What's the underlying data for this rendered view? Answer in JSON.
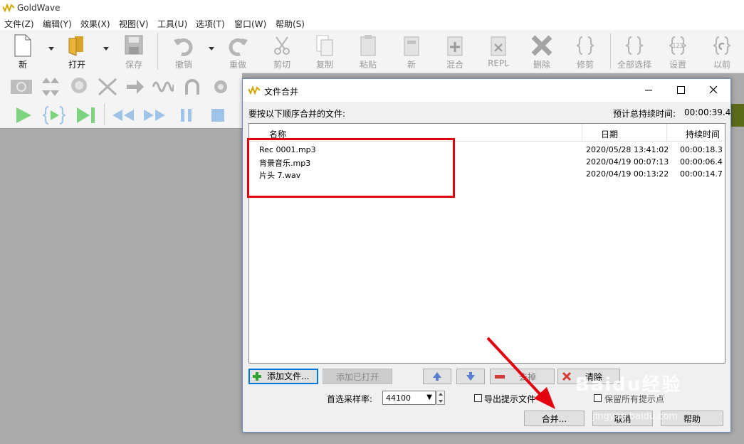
{
  "app": {
    "title": "GoldWave"
  },
  "menu": [
    "文件(Z)",
    "编辑(Y)",
    "效果(X)",
    "视图(V)",
    "工具(U)",
    "选项(T)",
    "窗口(W)",
    "帮助(S)"
  ],
  "toolbar": {
    "new": "新",
    "open": "打开",
    "save": "保存",
    "undo": "撤销",
    "redo": "重做",
    "cut": "剪切",
    "copy": "复制",
    "paste": "粘贴",
    "paste_new": "新",
    "mix": "混合",
    "repl": "REPL",
    "delete": "删除",
    "trim": "修剪",
    "select_all": "全部选择",
    "settings": "设置",
    "previous": "以前"
  },
  "dialog": {
    "title": "文件合并",
    "instruction": "要按以下顺序合并的文件:",
    "estimated_label": "预计总持续时间:",
    "estimated_value": "00:00:39.4",
    "columns": {
      "name": "名称",
      "date": "日期",
      "duration": "持续时间"
    },
    "files": [
      {
        "name": "Rec 0001.mp3",
        "date": "2020/05/28 13:41:02",
        "duration": "00:00:18.3"
      },
      {
        "name": "背景音乐.mp3",
        "date": "2020/04/19 00:07:13",
        "duration": "00:00:06.4"
      },
      {
        "name": "片头 7.wav",
        "date": "2020/04/19 00:13:22",
        "duration": "00:00:14.7"
      }
    ],
    "buttons": {
      "add_files": "添加文件...",
      "add_open": "添加已打开",
      "remove": "去掉",
      "clear": "清除",
      "merge": "合并...",
      "cancel": "取消",
      "help": "帮助"
    },
    "sample_rate_label": "首选采样率:",
    "sample_rate_value": "44100",
    "export_cues_label": "导出提示文件",
    "keep_cues_label": "保留所有提示点"
  },
  "watermark": {
    "brand": "Baidu经验",
    "url": "jingyan.baidu.com"
  },
  "colors": {
    "highlight_red": "#e3000f",
    "accent_blue": "#0078d7",
    "play_green": "#6cd46c"
  }
}
